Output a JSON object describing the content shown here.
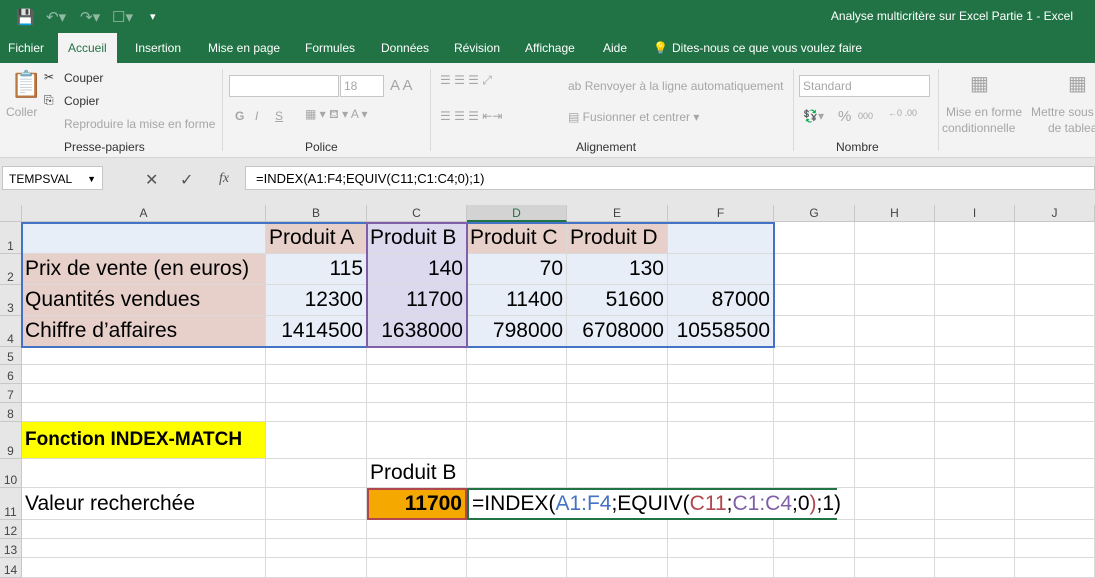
{
  "window": {
    "title": "Analyse multicritère sur Excel Partie 1  -  Excel",
    "qat": [
      "save-icon",
      "undo-icon",
      "redo-icon",
      "touch-mode-icon",
      "customize-icon"
    ]
  },
  "tabs": [
    "Fichier",
    "Accueil",
    "Insertion",
    "Mise en page",
    "Formules",
    "Données",
    "Révision",
    "Affichage",
    "Aide"
  ],
  "tell_me": "Dites-nous ce que vous voulez faire",
  "ribbon": {
    "clipboard": {
      "paste": "Coller",
      "cut": "Couper",
      "copy": "Copier",
      "format_painter": "Reproduire la mise en forme",
      "group": "Presse-papiers"
    },
    "font": {
      "font_name": "",
      "font_size": "18",
      "bold": "G",
      "italic": "I",
      "underline": "S",
      "group": "Police"
    },
    "alignment": {
      "wrap": "Renvoyer à la ligne automatiquement",
      "merge": "Fusionner et centrer",
      "group": "Alignement"
    },
    "number": {
      "format": "Standard",
      "percent": "%",
      "thousands": "000",
      "group": "Nombre"
    },
    "styles": {
      "conditional": "Mise en forme",
      "conditional2": "conditionnelle",
      "table": "Mettre sous",
      "table2": "de tableau"
    }
  },
  "formula_bar": {
    "name_box": "TEMPSVAL",
    "formula": "=INDEX(A1:F4;EQUIV(C11;C1:C4;0);1)"
  },
  "columns": [
    "A",
    "B",
    "C",
    "D",
    "E",
    "F",
    "G",
    "H",
    "I",
    "J"
  ],
  "rows": [
    "1",
    "2",
    "3",
    "4",
    "5",
    "6",
    "7",
    "8",
    "9",
    "10",
    "11",
    "12",
    "13",
    "14"
  ],
  "cells": {
    "B1": "Produit A",
    "C1": "Produit B",
    "D1": "Produit C",
    "E1": "Produit D",
    "A2": "Prix de vente (en euros)",
    "B2": "115",
    "C2": "140",
    "D2": "70",
    "E2": "130",
    "A3": "Quantités vendues",
    "B3": "12300",
    "C3": "11700",
    "D3": "11400",
    "E3": "51600",
    "F3": "87000",
    "A4": "Chiffre d’affaires",
    "B4": "1414500",
    "C4": "1638000",
    "D4": "798000",
    "E4": "6708000",
    "F4": "10558500",
    "A9": "Fonction INDEX-MATCH",
    "C10": "Produit B",
    "A11": "Valeur recherchée",
    "C11": "11700"
  },
  "edit_formula": {
    "parts": [
      "=INDEX(",
      "A1:F4",
      ";EQUIV(",
      "C11",
      ";",
      "C1:C4",
      ";0",
      ")",
      ";1)"
    ]
  },
  "colors": {
    "accent": "#217346",
    "label_fill": "#e6d0c9",
    "data_fill": "#e8eef8",
    "selected_col_fill": "#dcd8ee",
    "result_fill": "#f5a800",
    "title_fill": "#ffff00",
    "ref_blue": "#4472c4",
    "ref_red": "#b0464e",
    "ref_purple": "#7f60a8"
  }
}
